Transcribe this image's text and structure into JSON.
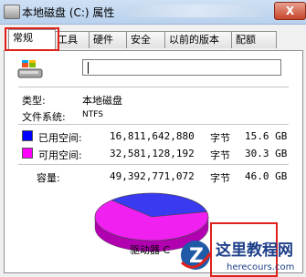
{
  "window": {
    "title": "本地磁盘 (C:) 属性",
    "close_label": "X"
  },
  "tabs": [
    {
      "label": "常规",
      "active": true
    },
    {
      "label": "工具"
    },
    {
      "label": "硬件"
    },
    {
      "label": "安全"
    },
    {
      "label": "以前的版本"
    },
    {
      "label": "配额"
    }
  ],
  "general": {
    "type_label": "类型:",
    "type_value": "本地磁盘",
    "fs_label": "文件系统:",
    "fs_value": "NTFS",
    "used": {
      "label": "已用空间:",
      "bytes": "16,811,642,880",
      "unit": "字节",
      "size": "15.6 GB",
      "color": "#0000ff"
    },
    "free": {
      "label": "可用空间:",
      "bytes": "32,581,128,192",
      "unit": "字节",
      "size": "30.3 GB",
      "color": "#ff00ff"
    },
    "capacity": {
      "label": "容量:",
      "bytes": "49,392,771,072",
      "unit": "字节",
      "size": "46.0 GB"
    },
    "drive_label": "驱动器 C"
  },
  "chart_data": {
    "type": "pie",
    "values": [
      15.6,
      30.3
    ],
    "labels": [
      "已用空间",
      "可用空间"
    ],
    "colors": [
      "#3a3af0",
      "#f020f0"
    ]
  },
  "watermark": {
    "text_cn": "这里教程网",
    "text_en": "herecours.com"
  }
}
